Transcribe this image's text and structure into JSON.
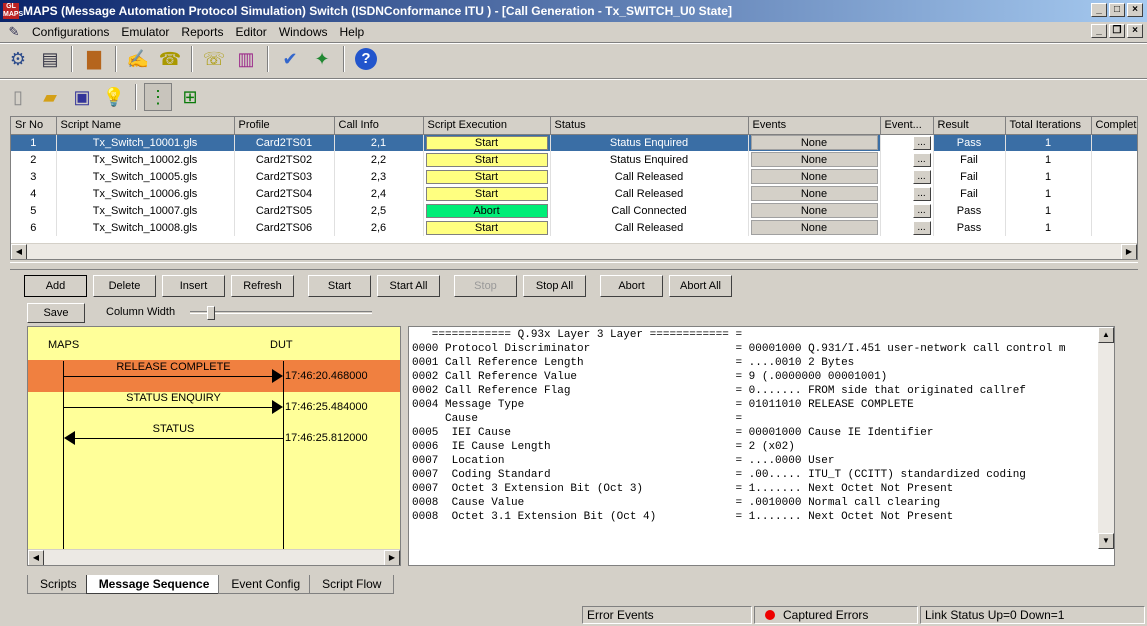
{
  "window": {
    "title": "MAPS (Message Automation Protocol Simulation) Switch (ISDNConformance ITU ) - [Call Generation - Tx_SWITCH_U0 State]"
  },
  "menu": [
    "Configurations",
    "Emulator",
    "Reports",
    "Editor",
    "Windows",
    "Help"
  ],
  "toolbar1": [
    "gear-icon",
    "notebook-icon",
    "briefcase-icon",
    "script-edit-icon",
    "phone-icon",
    "handset-icon",
    "book-icon",
    "check-icon",
    "wand-icon",
    "help-icon"
  ],
  "toolbar2": [
    "new-file-icon",
    "open-folder-icon",
    "save-disk-icon",
    "bulb-icon",
    "tree-icon",
    "network-icon"
  ],
  "grid": {
    "columns": [
      "Sr No",
      "Script Name",
      "Profile",
      "Call Info",
      "Script Execution",
      "Status",
      "Events",
      "Event...",
      "Result",
      "Total Iterations",
      "Complete"
    ],
    "rows": [
      {
        "sr": "1",
        "script": "Tx_Switch_10001.gls",
        "profile": "Card2TS01",
        "call": "2,1",
        "exec": "Start",
        "status": "Status Enquired",
        "events": "None",
        "result": "Pass",
        "iter": "1"
      },
      {
        "sr": "2",
        "script": "Tx_Switch_10002.gls",
        "profile": "Card2TS02",
        "call": "2,2",
        "exec": "Start",
        "status": "Status Enquired",
        "events": "None",
        "result": "Fail",
        "iter": "1"
      },
      {
        "sr": "3",
        "script": "Tx_Switch_10005.gls",
        "profile": "Card2TS03",
        "call": "2,3",
        "exec": "Start",
        "status": "Call Released",
        "events": "None",
        "result": "Fail",
        "iter": "1"
      },
      {
        "sr": "4",
        "script": "Tx_Switch_10006.gls",
        "profile": "Card2TS04",
        "call": "2,4",
        "exec": "Start",
        "status": "Call Released",
        "events": "None",
        "result": "Fail",
        "iter": "1"
      },
      {
        "sr": "5",
        "script": "Tx_Switch_10007.gls",
        "profile": "Card2TS05",
        "call": "2,5",
        "exec": "Abort",
        "status": "Call Connected",
        "events": "None",
        "result": "Pass",
        "iter": "1"
      },
      {
        "sr": "6",
        "script": "Tx_Switch_10008.gls",
        "profile": "Card2TS06",
        "call": "2,6",
        "exec": "Start",
        "status": "Call Released",
        "events": "None",
        "result": "Pass",
        "iter": "1"
      }
    ],
    "event_button": "...",
    "colors": {
      "start": "#ffff80",
      "abort": "#00ee77",
      "selected": "#3a6ea5"
    }
  },
  "buttons": {
    "add": "Add",
    "delete": "Delete",
    "insert": "Insert",
    "refresh": "Refresh",
    "start": "Start",
    "start_all": "Start All",
    "stop": "Stop",
    "stop_all": "Stop All",
    "abort": "Abort",
    "abort_all": "Abort All",
    "save": "Save"
  },
  "column_width": {
    "label": "Column Width",
    "value_fraction": 0.1
  },
  "sequence": {
    "left_label": "MAPS",
    "right_label": "DUT",
    "messages": [
      {
        "label": "RELEASE COMPLETE",
        "time": "17:46:20.468000",
        "direction": "to-dut"
      },
      {
        "label": "STATUS ENQUIRY",
        "time": "17:46:25.484000",
        "direction": "to-dut"
      },
      {
        "label": "STATUS",
        "time": "17:46:25.812000",
        "direction": "to-maps"
      }
    ],
    "highlight_color": "#f08040"
  },
  "detail_lines": [
    "   ============ Q.93x Layer 3 Layer ============ =",
    "0000 Protocol Discriminator                      = 00001000 Q.931/I.451 user-network call control m",
    "0001 Call Reference Length                       = ....0010 2 Bytes",
    "0002 Call Reference Value                        = 9 (.0000000 00001001)",
    "0002 Call Reference Flag                         = 0....... FROM side that originated callref",
    "0004 Message Type                                = 01011010 RELEASE COMPLETE",
    "     Cause                                       =",
    "0005  IEI Cause                                  = 00001000 Cause IE Identifier",
    "0006  IE Cause Length                            = 2 (x02)",
    "0007  Location                                   = ....0000 User",
    "0007  Coding Standard                            = .00..... ITU_T (CCITT) standardized coding",
    "0007  Octet 3 Extension Bit (Oct 3)              = 1....... Next Octet Not Present",
    "0008  Cause Value                                = .0010000 Normal call clearing",
    "0008  Octet 3.1 Extension Bit (Oct 4)            = 1....... Next Octet Not Present"
  ],
  "tabs": [
    "Scripts",
    "Message Sequence",
    "Event Config",
    "Script Flow"
  ],
  "active_tab": "Message Sequence",
  "status": {
    "error_events": "Error Events",
    "captured_errors": "Captured Errors",
    "link_status": "Link Status Up=0 Down=1"
  }
}
